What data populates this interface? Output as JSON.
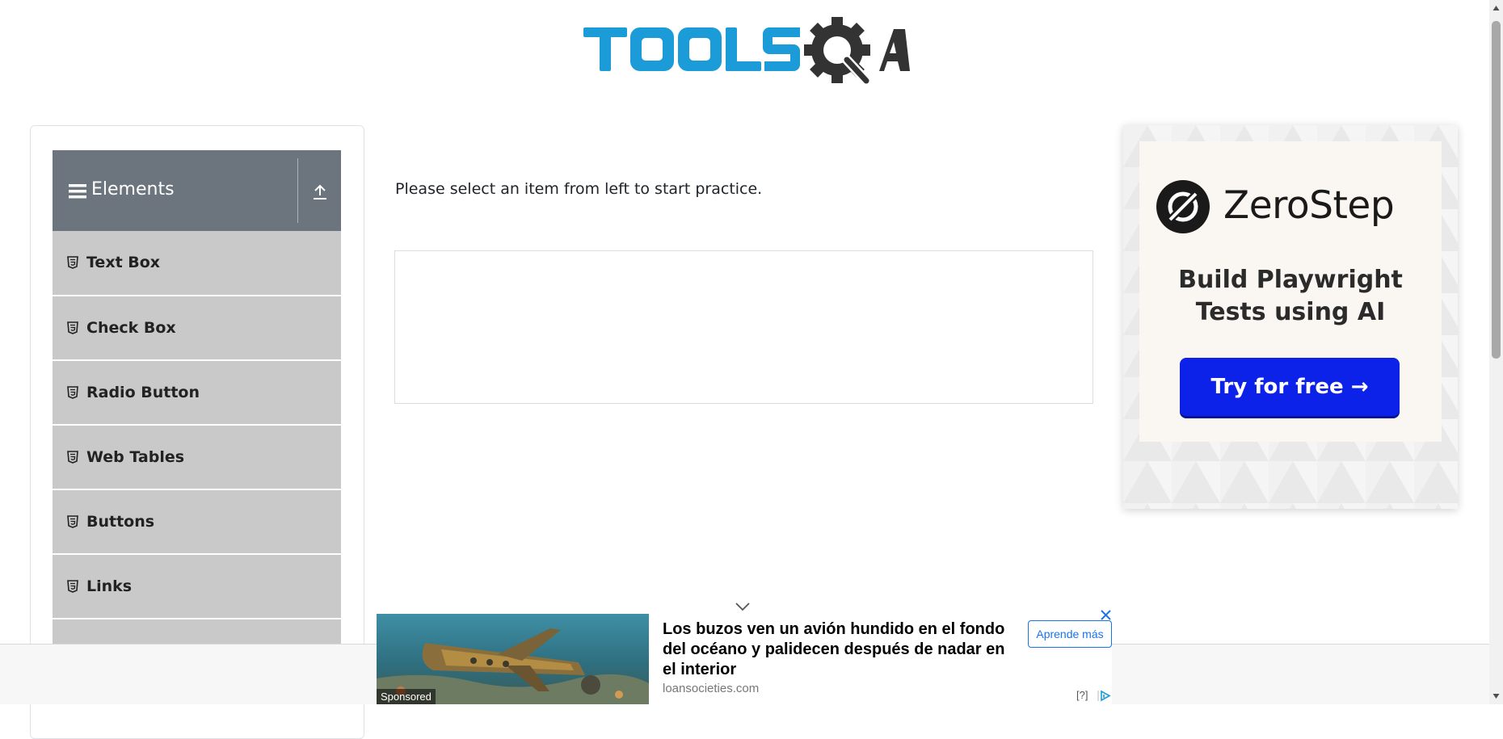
{
  "header": {
    "logo_text": "TOOLSQA"
  },
  "sidebar": {
    "group_title": "Elements",
    "items": [
      {
        "label": "Text Box"
      },
      {
        "label": "Check Box"
      },
      {
        "label": "Radio Button"
      },
      {
        "label": "Web Tables"
      },
      {
        "label": "Buttons"
      },
      {
        "label": "Links"
      }
    ]
  },
  "main": {
    "instruction": "Please select an item from left to start practice."
  },
  "right_ad": {
    "brand": "ZeroStep",
    "tagline": "Build Playwright Tests using AI",
    "cta_label": "Try for free →",
    "cta_color": "#0d22e8"
  },
  "bottom_ad": {
    "sponsored_label": "Sponsored",
    "headline": "Los buzos ven un avión hundido en el fondo del océano y palidecen después de nadar en el interior",
    "domain": "loansocieties.com",
    "button_label": "Aprende más",
    "info_label": "[?]"
  },
  "colors": {
    "logo_blue": "#1b9bd7",
    "logo_dark": "#333333",
    "sidebar_header": "#6c757d",
    "sidebar_item": "#c9c9c9"
  }
}
